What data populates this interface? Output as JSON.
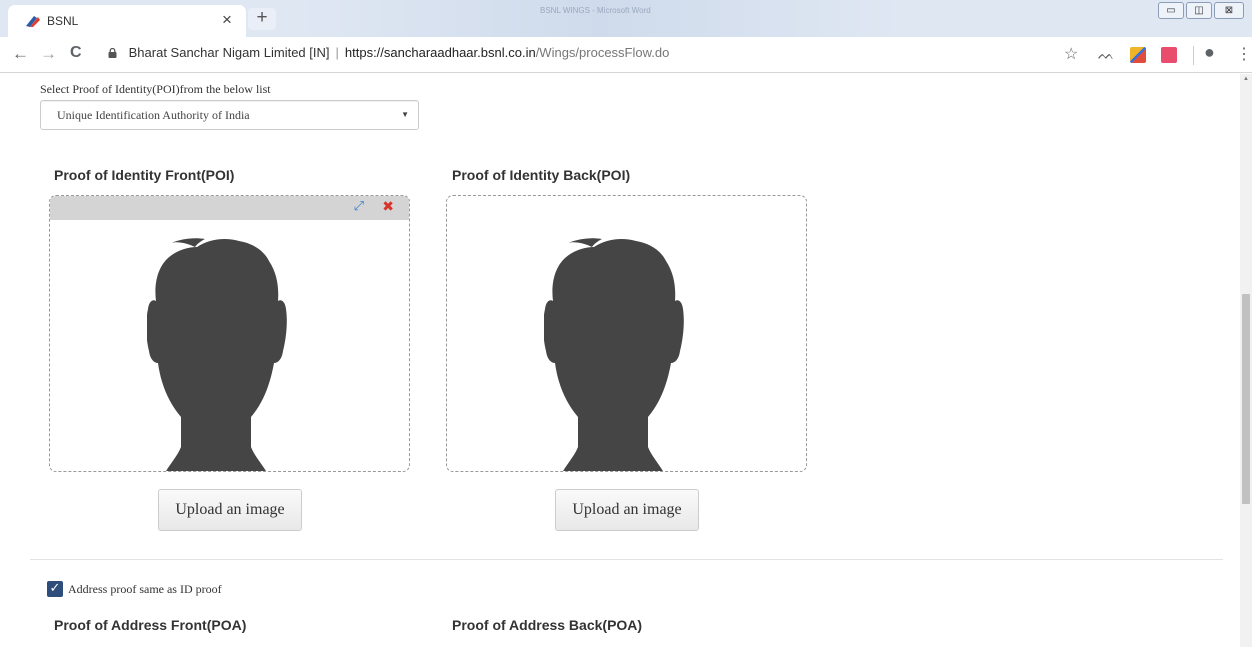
{
  "browser": {
    "tab_title": "BSNL",
    "tab_close": "×",
    "new_tab": "+",
    "background_window_title": "BSNL WINGS - Microsoft Word",
    "window_controls": [
      "▭",
      "◫",
      "⊠"
    ],
    "nav": {
      "back": "←",
      "forward": "→",
      "reload": "C"
    },
    "address": {
      "site_name": "Bharat Sanchar Nigam Limited [IN]",
      "separator": "|",
      "url_scheme_host": "https://sancharaadhaar.bsnl.co.in",
      "url_path": "/Wings/processFlow.do"
    },
    "toolbar_icons": [
      "star-icon",
      "cast-icon",
      "extension-icon",
      "mail-extension-icon",
      "account-icon",
      "menu-icon"
    ],
    "glyphs": {
      "star": "☆",
      "cast": "ᨓ",
      "account": "●",
      "menu": "⋮"
    }
  },
  "form": {
    "poi_select_label": "Select Proof of Identity(POI)from the below list",
    "poi_select_value": "Unique Identification Authority of India",
    "poi_select_caret": "▼",
    "poi_front_title": "Proof of Identity Front(POI)",
    "poi_back_title": "Proof of Identity Back(POI)",
    "expand_glyph": "⤢",
    "remove_glyph": "✖",
    "upload_label": "Upload an image",
    "address_same_checked": true,
    "address_same_label": "Address proof same as ID proof",
    "check_glyph": "✓",
    "poa_front_title": "Proof of Address Front(POA)",
    "poa_back_title": "Proof of Address Back(POA)"
  },
  "colors": {
    "checkbox": "#2e4d7b",
    "silhouette": "#454545",
    "remove": "#d9342b",
    "expand": "#3b7fd6"
  }
}
